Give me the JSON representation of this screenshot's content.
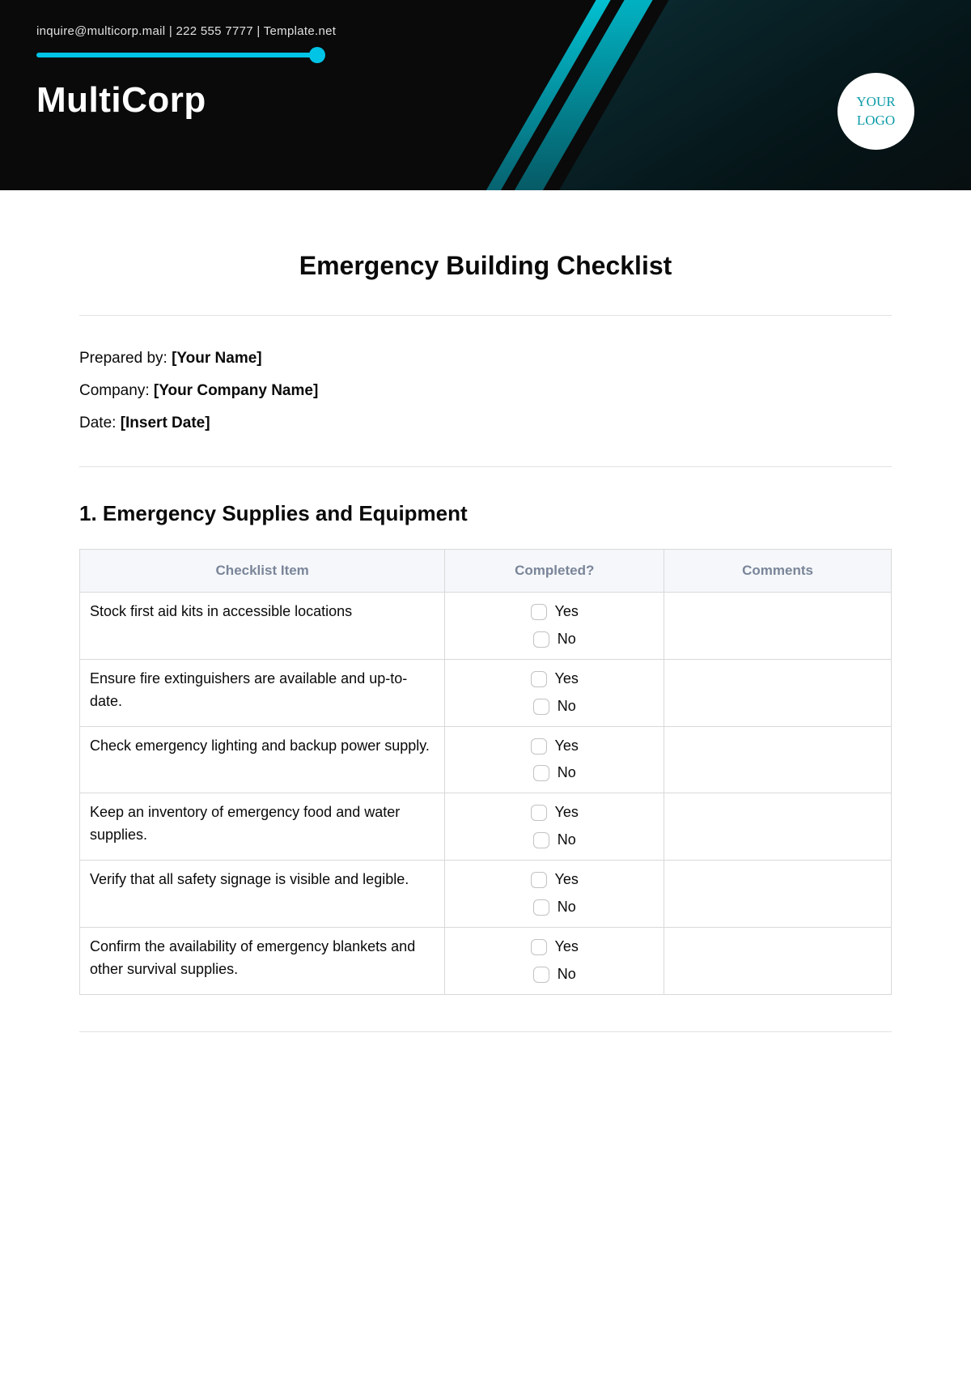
{
  "header": {
    "contact": "inquire@multicorp.mail | 222 555 7777 | Template.net",
    "company": "MultiCorp",
    "logo_line1": "YOUR",
    "logo_line2": "LOGO"
  },
  "title": "Emergency Building Checklist",
  "meta": {
    "prepared_label": "Prepared by: ",
    "prepared_value": "[Your Name]",
    "company_label": "Company: ",
    "company_value": "[Your Company Name]",
    "date_label": "Date: ",
    "date_value": "[Insert Date]"
  },
  "section": {
    "heading": "1. Emergency Supplies and Equipment",
    "columns": {
      "c1": "Checklist Item",
      "c2": "Completed?",
      "c3": "Comments"
    },
    "yes": "Yes",
    "no": "No",
    "items": [
      "Stock first aid kits in accessible locations",
      "Ensure fire extinguishers are available and up-to-date.",
      "Check emergency lighting and backup power supply.",
      "Keep an inventory of emergency food and water supplies.",
      "Verify that all safety signage is visible and legible.",
      "Confirm the availability of emergency blankets and other survival supplies."
    ]
  }
}
